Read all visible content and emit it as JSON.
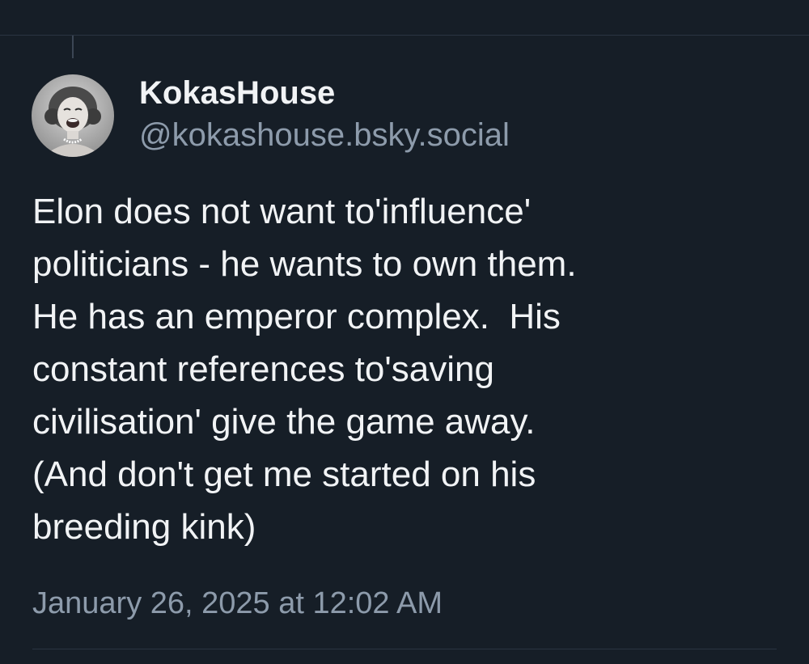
{
  "post": {
    "author": {
      "display_name": "KokasHouse",
      "handle": "@kokashouse.bsky.social",
      "avatar_icon": "vintage-portrait-avatar"
    },
    "text": "Elon does not want to'influence'\npoliticians - he wants to own them.\nHe has an emperor complex.  His\nconstant references to'saving\ncivilisation' give the game away.\n(And don't get me started on his\nbreeding kink)",
    "timestamp": "January 26, 2025 at 12:02 AM"
  },
  "colors": {
    "background": "#161e27",
    "primary_text": "#f1f3f5",
    "secondary_text": "#8d9bab",
    "divider": "#2a3441"
  }
}
